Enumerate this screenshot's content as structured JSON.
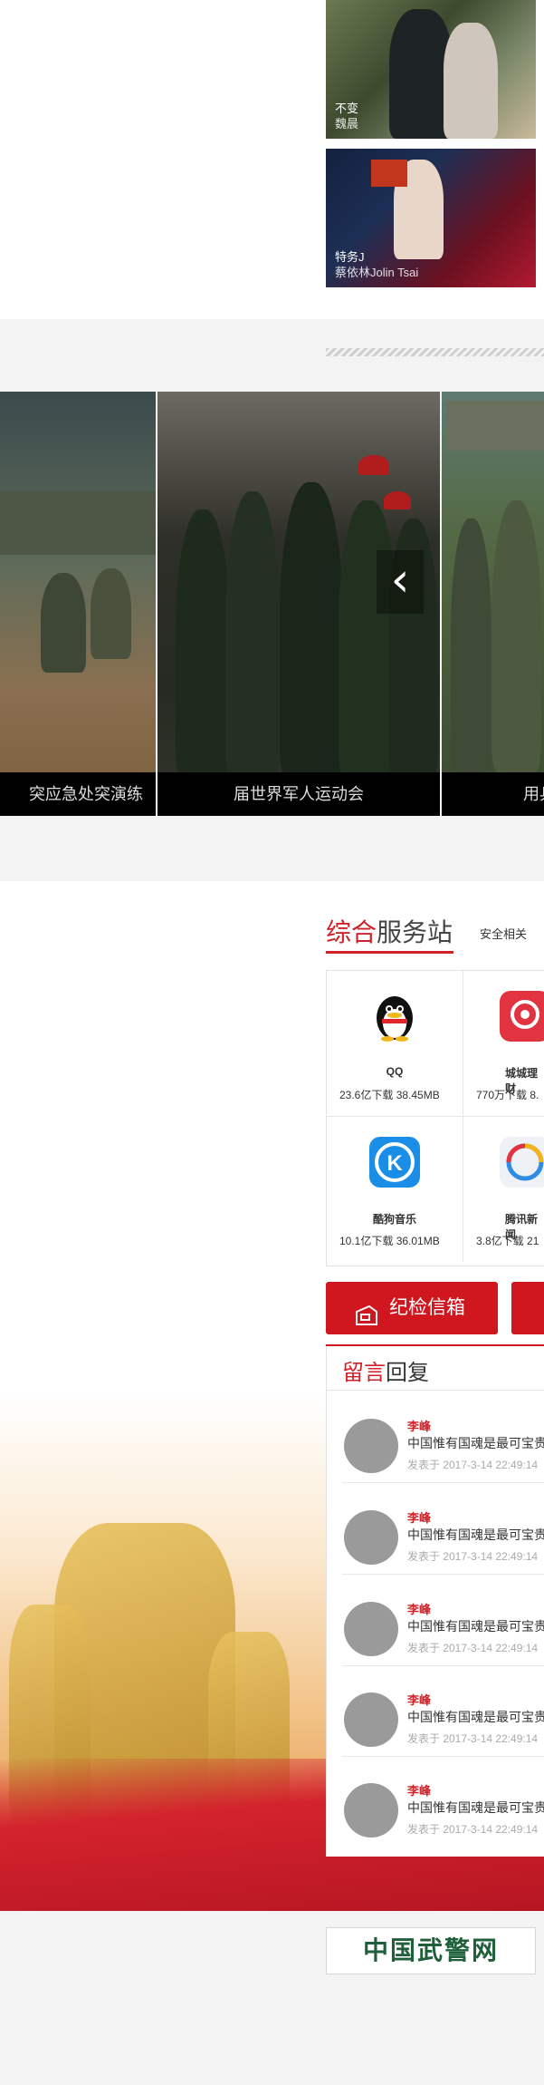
{
  "mv_cards": [
    {
      "title": "不变",
      "artist": "魏晨"
    },
    {
      "title": "特务J",
      "artist": "蔡依林Jolin Tsai"
    }
  ],
  "gallery": {
    "items": [
      {
        "label": "突应急处突演练"
      },
      {
        "label": "届世界军人运动会"
      },
      {
        "label": "用兵"
      }
    ],
    "prev_glyph": "‹"
  },
  "service": {
    "title_red": "综合",
    "title_rest": "服务站",
    "tab": "安全相关",
    "apps": [
      {
        "name": "QQ",
        "meta": "23.6亿下载 38.45MB",
        "icon": "qq-icon"
      },
      {
        "name": "城城理财",
        "meta": "770万下载 8.",
        "icon": "finance-icon"
      },
      {
        "name": "酷狗音乐",
        "meta": "10.1亿下载 36.01MB",
        "icon": "kugou-icon"
      },
      {
        "name": "腾讯新闻",
        "meta": "3.8亿下载 21",
        "icon": "tencent-news-icon"
      }
    ]
  },
  "mailbox": {
    "label": "纪检信箱",
    "icon": "mailbox-icon"
  },
  "messages": {
    "title_red": "留言",
    "title_rest": "回复",
    "items": [
      {
        "author": "李峰",
        "text": "中国惟有国魂是最可宝贵",
        "time": "发表于 2017-3-14 22:49:14"
      },
      {
        "author": "李峰",
        "text": "中国惟有国魂是最可宝贵",
        "time": "发表于 2017-3-14 22:49:14"
      },
      {
        "author": "李峰",
        "text": "中国惟有国魂是最可宝贵",
        "time": "发表于 2017-3-14 22:49:14"
      },
      {
        "author": "李峰",
        "text": "中国惟有国魂是最可宝贵",
        "time": "发表于 2017-3-14 22:49:14"
      },
      {
        "author": "李峰",
        "text": "中国惟有国魂是最可宝贵",
        "time": "发表于 2017-3-14 22:49:14"
      }
    ]
  },
  "footer_logo": {
    "text": "中国武警网"
  },
  "colors": {
    "accent": "#d02129",
    "button": "#d0161f"
  }
}
